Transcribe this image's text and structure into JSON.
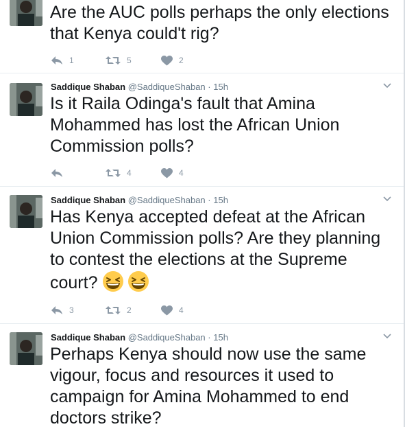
{
  "tweets": [
    {
      "show_header": false,
      "text": "Are the AUC polls perhaps the only elections that Kenya could't rig?",
      "counts": {
        "reply": "1",
        "retweet": "5",
        "like": "2"
      }
    },
    {
      "show_header": true,
      "name": "Saddique Shaban",
      "handle": "@SaddiqueShaban",
      "dot": "·",
      "time": "15h",
      "text": "Is it Raila Odinga's fault that Amina Mohammed has lost the African Union Commission polls?",
      "counts": {
        "reply": "",
        "retweet": "4",
        "like": "4"
      }
    },
    {
      "show_header": true,
      "name": "Saddique Shaban",
      "handle": "@SaddiqueShaban",
      "dot": "·",
      "time": "15h",
      "text": "Has Kenya accepted defeat at the African Union Commission polls? Are they planning to contest the elections at the Supreme court?",
      "emojis": [
        "grinning-squinting-face-icon",
        "grinning-squinting-face-icon"
      ],
      "counts": {
        "reply": "3",
        "retweet": "2",
        "like": "4"
      }
    },
    {
      "show_header": true,
      "name": "Saddique Shaban",
      "handle": "@SaddiqueShaban",
      "dot": "·",
      "time": "15h",
      "text": "Perhaps Kenya should now use the same vigour, focus and resources it used to campaign for Amina Mohammed to end doctors strike?",
      "counts": null
    }
  ],
  "colors": {
    "text": "#14171a",
    "meta": "#657786",
    "action": "#8b98a5",
    "divider": "#e6ecf0",
    "emoji": "#ffcc4d"
  }
}
